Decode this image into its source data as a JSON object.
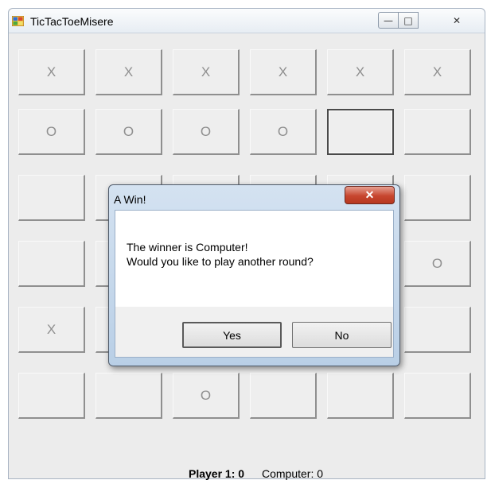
{
  "window": {
    "title": "TicTacToeMisere",
    "controls": {
      "minimize": "—",
      "maximize": "□",
      "close": "✕"
    }
  },
  "board": {
    "rows": [
      [
        "X",
        "X",
        "X",
        "X",
        "X",
        "X"
      ],
      [
        "O",
        "O",
        "O",
        "O",
        "",
        ""
      ],
      [
        "",
        "",
        "",
        "",
        "",
        ""
      ],
      [
        "",
        "",
        "",
        "",
        "",
        "O"
      ],
      [
        "X",
        "",
        "",
        "",
        "",
        ""
      ],
      [
        "",
        "",
        "O",
        "",
        "",
        ""
      ]
    ],
    "focused_cell": "1-4"
  },
  "score": {
    "player": "Player 1: 0",
    "computer": "Computer: 0"
  },
  "dialog": {
    "title": "A Win!",
    "close_label": "✕",
    "line1": "The winner is Computer!",
    "line2": "Would you like to play another round?",
    "yes_label": "Yes",
    "no_label": "No"
  },
  "colors": {
    "window_bg": "#ececec",
    "cell_text": "#8f8f8f",
    "close_red": "#c7462f"
  }
}
